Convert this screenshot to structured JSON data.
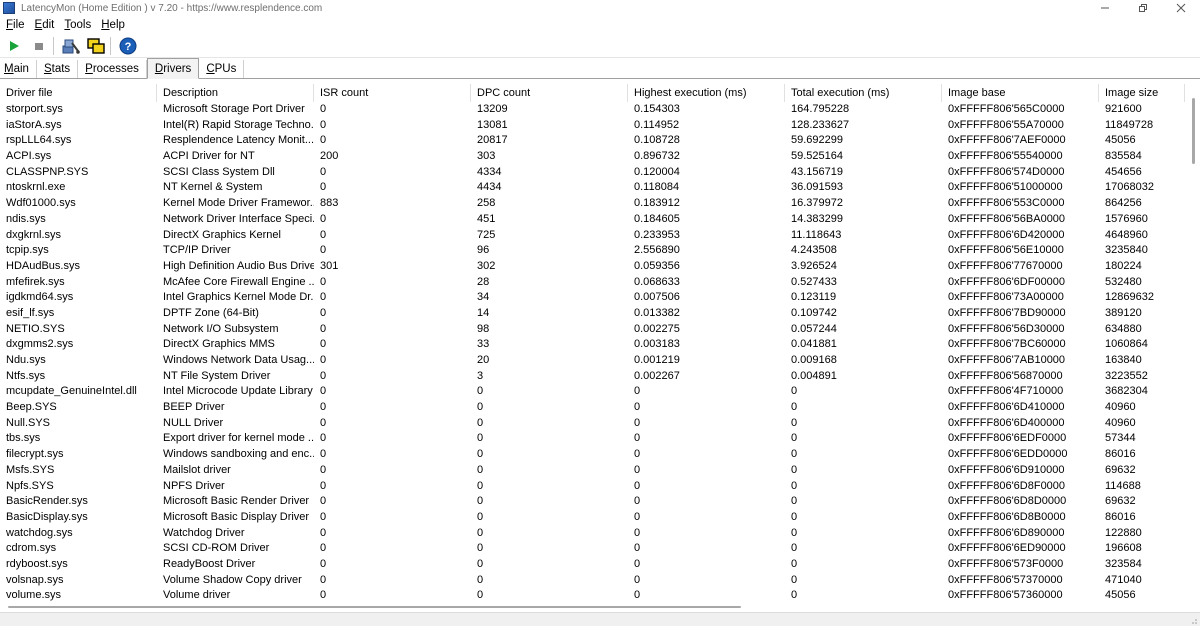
{
  "window": {
    "title": "LatencyMon  (Home Edition )  v 7.20 - https://www.resplendence.com"
  },
  "menu": [
    {
      "u": "F",
      "rest": "ile"
    },
    {
      "u": "E",
      "rest": "dit"
    },
    {
      "u": "T",
      "rest": "ools"
    },
    {
      "u": "H",
      "rest": "elp"
    }
  ],
  "toolbar": {
    "icons": [
      "play-icon",
      "stop-icon",
      "driver-icon",
      "windows-icon",
      "help-icon"
    ],
    "colors": {
      "play": "#1aa33a",
      "stop": "#7a7a7a",
      "help": "#1b5fb8"
    }
  },
  "tabs": [
    {
      "u": "M",
      "rest": "ain"
    },
    {
      "u": "S",
      "rest": "tats"
    },
    {
      "u": "P",
      "rest": "rocesses"
    },
    {
      "u": "D",
      "rest": "rivers",
      "active": true
    },
    {
      "u": "C",
      "rest": "PUs"
    }
  ],
  "table": {
    "columns": [
      "Driver file",
      "Description",
      "ISR count",
      "DPC count",
      "Highest execution (ms)",
      "Total execution (ms)",
      "Image base",
      "Image size"
    ],
    "rows": [
      [
        "storport.sys",
        "Microsoft Storage Port Driver",
        "0",
        "13209",
        "0.154303",
        "164.795228",
        "0xFFFFF806'565C0000",
        "921600"
      ],
      [
        "iaStorA.sys",
        "Intel(R) Rapid Storage Techno...",
        "0",
        "13081",
        "0.114952",
        "128.233627",
        "0xFFFFF806'55A70000",
        "11849728"
      ],
      [
        "rspLLL64.sys",
        "Resplendence Latency Monit...",
        "0",
        "20817",
        "0.108728",
        "59.692299",
        "0xFFFFF806'7AEF0000",
        "45056"
      ],
      [
        "ACPI.sys",
        "ACPI Driver for NT",
        "200",
        "303",
        "0.896732",
        "59.525164",
        "0xFFFFF806'55540000",
        "835584"
      ],
      [
        "CLASSPNP.SYS",
        "SCSI Class System Dll",
        "0",
        "4334",
        "0.120004",
        "43.156719",
        "0xFFFFF806'574D0000",
        "454656"
      ],
      [
        "ntoskrnl.exe",
        "NT Kernel & System",
        "0",
        "4434",
        "0.118084",
        "36.091593",
        "0xFFFFF806'51000000",
        "17068032"
      ],
      [
        "Wdf01000.sys",
        "Kernel Mode Driver Framewor...",
        "883",
        "258",
        "0.183912",
        "16.379972",
        "0xFFFFF806'553C0000",
        "864256"
      ],
      [
        "ndis.sys",
        "Network Driver Interface Speci...",
        "0",
        "451",
        "0.184605",
        "14.383299",
        "0xFFFFF806'56BA0000",
        "1576960"
      ],
      [
        "dxgkrnl.sys",
        "DirectX Graphics Kernel",
        "0",
        "725",
        "0.233953",
        "11.118643",
        "0xFFFFF806'6D420000",
        "4648960"
      ],
      [
        "tcpip.sys",
        "TCP/IP Driver",
        "0",
        "96",
        "2.556890",
        "4.243508",
        "0xFFFFF806'56E10000",
        "3235840"
      ],
      [
        "HDAudBus.sys",
        "High Definition Audio Bus Driver",
        "301",
        "302",
        "0.059356",
        "3.926524",
        "0xFFFFF806'77670000",
        "180224"
      ],
      [
        "mfefirek.sys",
        "McAfee Core Firewall Engine ...",
        "0",
        "28",
        "0.068633",
        "0.527433",
        "0xFFFFF806'6DF00000",
        "532480"
      ],
      [
        "igdkmd64.sys",
        "Intel Graphics Kernel Mode Dr...",
        "0",
        "34",
        "0.007506",
        "0.123119",
        "0xFFFFF806'73A00000",
        "12869632"
      ],
      [
        "esif_lf.sys",
        "DPTF Zone (64-Bit)",
        "0",
        "14",
        "0.013382",
        "0.109742",
        "0xFFFFF806'7BD90000",
        "389120"
      ],
      [
        "NETIO.SYS",
        "Network I/O Subsystem",
        "0",
        "98",
        "0.002275",
        "0.057244",
        "0xFFFFF806'56D30000",
        "634880"
      ],
      [
        "dxgmms2.sys",
        "DirectX Graphics MMS",
        "0",
        "33",
        "0.003183",
        "0.041881",
        "0xFFFFF806'7BC60000",
        "1060864"
      ],
      [
        "Ndu.sys",
        "Windows Network Data Usag...",
        "0",
        "20",
        "0.001219",
        "0.009168",
        "0xFFFFF806'7AB10000",
        "163840"
      ],
      [
        "Ntfs.sys",
        "NT File System Driver",
        "0",
        "3",
        "0.002267",
        "0.004891",
        "0xFFFFF806'56870000",
        "3223552"
      ],
      [
        "mcupdate_GenuineIntel.dll",
        "Intel Microcode Update Library",
        "0",
        "0",
        "0",
        "0",
        "0xFFFFF806'4F710000",
        "3682304"
      ],
      [
        "Beep.SYS",
        "BEEP Driver",
        "0",
        "0",
        "0",
        "0",
        "0xFFFFF806'6D410000",
        "40960"
      ],
      [
        "Null.SYS",
        "NULL Driver",
        "0",
        "0",
        "0",
        "0",
        "0xFFFFF806'6D400000",
        "40960"
      ],
      [
        "tbs.sys",
        "Export driver for kernel mode ...",
        "0",
        "0",
        "0",
        "0",
        "0xFFFFF806'6EDF0000",
        "57344"
      ],
      [
        "filecrypt.sys",
        "Windows sandboxing and enc...",
        "0",
        "0",
        "0",
        "0",
        "0xFFFFF806'6EDD0000",
        "86016"
      ],
      [
        "Msfs.SYS",
        "Mailslot driver",
        "0",
        "0",
        "0",
        "0",
        "0xFFFFF806'6D910000",
        "69632"
      ],
      [
        "Npfs.SYS",
        "NPFS Driver",
        "0",
        "0",
        "0",
        "0",
        "0xFFFFF806'6D8F0000",
        "114688"
      ],
      [
        "BasicRender.sys",
        "Microsoft Basic Render Driver",
        "0",
        "0",
        "0",
        "0",
        "0xFFFFF806'6D8D0000",
        "69632"
      ],
      [
        "BasicDisplay.sys",
        "Microsoft Basic Display Driver",
        "0",
        "0",
        "0",
        "0",
        "0xFFFFF806'6D8B0000",
        "86016"
      ],
      [
        "watchdog.sys",
        "Watchdog Driver",
        "0",
        "0",
        "0",
        "0",
        "0xFFFFF806'6D890000",
        "122880"
      ],
      [
        "cdrom.sys",
        "SCSI CD-ROM Driver",
        "0",
        "0",
        "0",
        "0",
        "0xFFFFF806'6ED90000",
        "196608"
      ],
      [
        "rdyboost.sys",
        "ReadyBoost Driver",
        "0",
        "0",
        "0",
        "0",
        "0xFFFFF806'573F0000",
        "323584"
      ],
      [
        "volsnap.sys",
        "Volume Shadow Copy driver",
        "0",
        "0",
        "0",
        "0",
        "0xFFFFF806'57370000",
        "471040"
      ],
      [
        "volume.sys",
        "Volume driver",
        "0",
        "0",
        "0",
        "0",
        "0xFFFFF806'57360000",
        "45056"
      ]
    ]
  }
}
